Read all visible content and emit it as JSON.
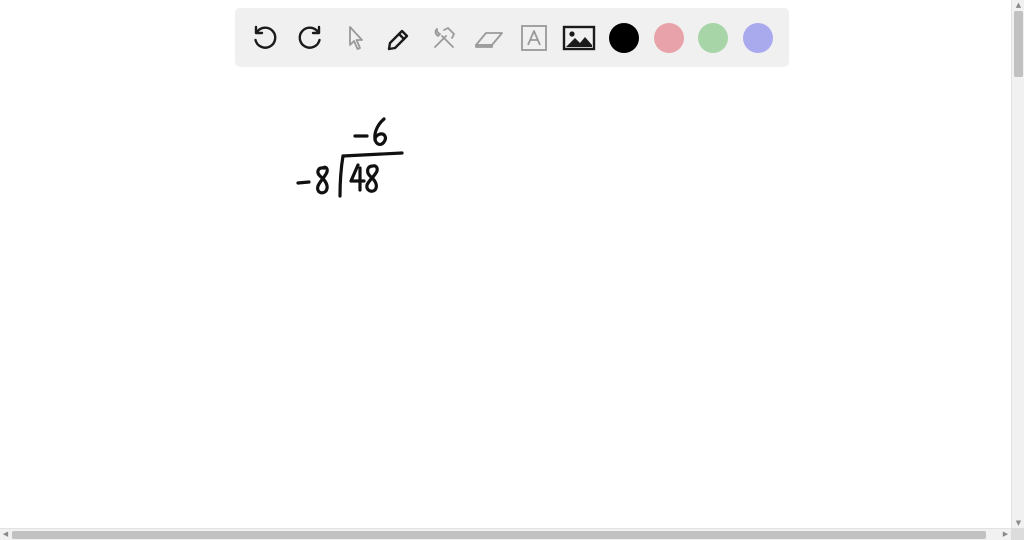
{
  "toolbar": {
    "tools": [
      {
        "name": "undo",
        "icon": "undo-icon"
      },
      {
        "name": "redo",
        "icon": "redo-icon"
      },
      {
        "name": "select",
        "icon": "pointer-icon"
      },
      {
        "name": "pen",
        "icon": "pen-icon"
      },
      {
        "name": "tools",
        "icon": "wrench-hammer-icon"
      },
      {
        "name": "eraser",
        "icon": "eraser-icon"
      },
      {
        "name": "text",
        "icon": "text-box-icon"
      },
      {
        "name": "image",
        "icon": "image-icon"
      }
    ],
    "colors": [
      "#000000",
      "#e8a3aa",
      "#a8d5a8",
      "#a9a9ee"
    ],
    "selected_color": "#000000"
  },
  "handwriting": {
    "quotient": "-6",
    "divisor": "-8",
    "dividend": "48"
  }
}
